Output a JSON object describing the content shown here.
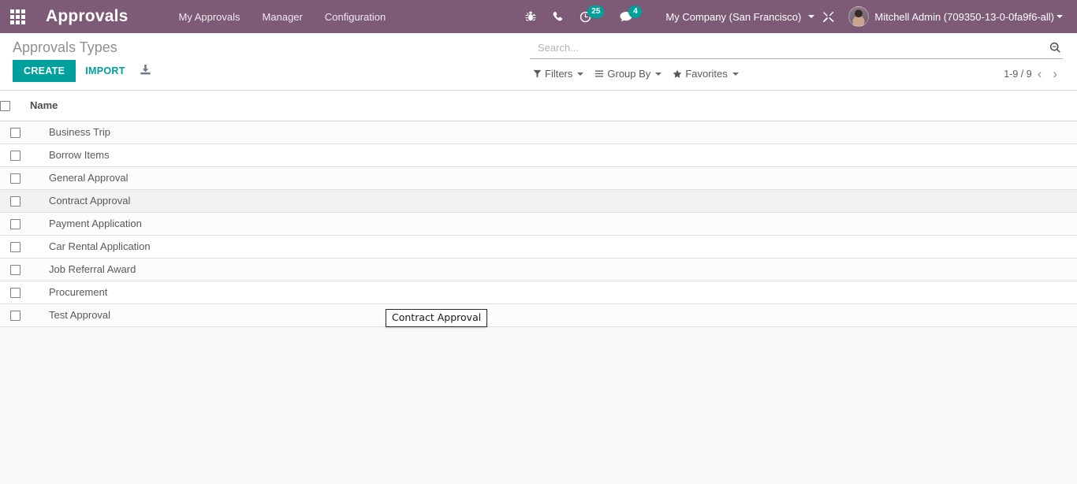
{
  "navbar": {
    "apps_icon": "apps-grid-icon",
    "brand": "Approvals",
    "menu": [
      {
        "label": "My Approvals"
      },
      {
        "label": "Manager"
      },
      {
        "label": "Configuration"
      }
    ],
    "systray": [
      {
        "name": "bug-icon",
        "badge": null
      },
      {
        "name": "phone-icon",
        "badge": null
      },
      {
        "name": "activity-clock-icon",
        "badge": "25"
      },
      {
        "name": "messages-chat-icon",
        "badge": "4"
      }
    ],
    "company": "My Company (San Francisco)",
    "debug_icon": "wrench-screwdriver-icon",
    "user": "Mitchell Admin (709350-13-0-0fa9f6-all)"
  },
  "control_panel": {
    "breadcrumb": "Approvals Types",
    "create_label": "CREATE",
    "import_label": "IMPORT",
    "export_icon": "download-export-icon",
    "search": {
      "value": "",
      "placeholder": "Search...",
      "icon": "search-magnifier-icon"
    },
    "filters": [
      {
        "label": "Filters",
        "icon": "filter-funnel-icon"
      },
      {
        "label": "Group By",
        "icon": "group-lines-icon"
      },
      {
        "label": "Favorites",
        "icon": "star-icon"
      }
    ],
    "pager": {
      "count": "1-9 / 9",
      "prev": "‹",
      "next": "›"
    }
  },
  "list": {
    "header": {
      "select_all": "select-all-checkbox",
      "name": "Name"
    },
    "rows": [
      {
        "name": "Business Trip",
        "hovered": false
      },
      {
        "name": "Borrow Items",
        "hovered": false
      },
      {
        "name": "General Approval",
        "hovered": false
      },
      {
        "name": "Contract Approval",
        "hovered": true
      },
      {
        "name": "Payment Application",
        "hovered": false
      },
      {
        "name": "Car Rental Application",
        "hovered": false
      },
      {
        "name": "Job Referral Award",
        "hovered": false
      },
      {
        "name": "Procurement",
        "hovered": false
      },
      {
        "name": "Test Approval",
        "hovered": false
      }
    ]
  },
  "tooltip": {
    "text": "Contract Approval"
  },
  "colors": {
    "navbar_bg": "#7d5a76",
    "accent": "#00a09d",
    "page_bg": "#f9f9f9",
    "row_hover": "#f2f2f2"
  }
}
